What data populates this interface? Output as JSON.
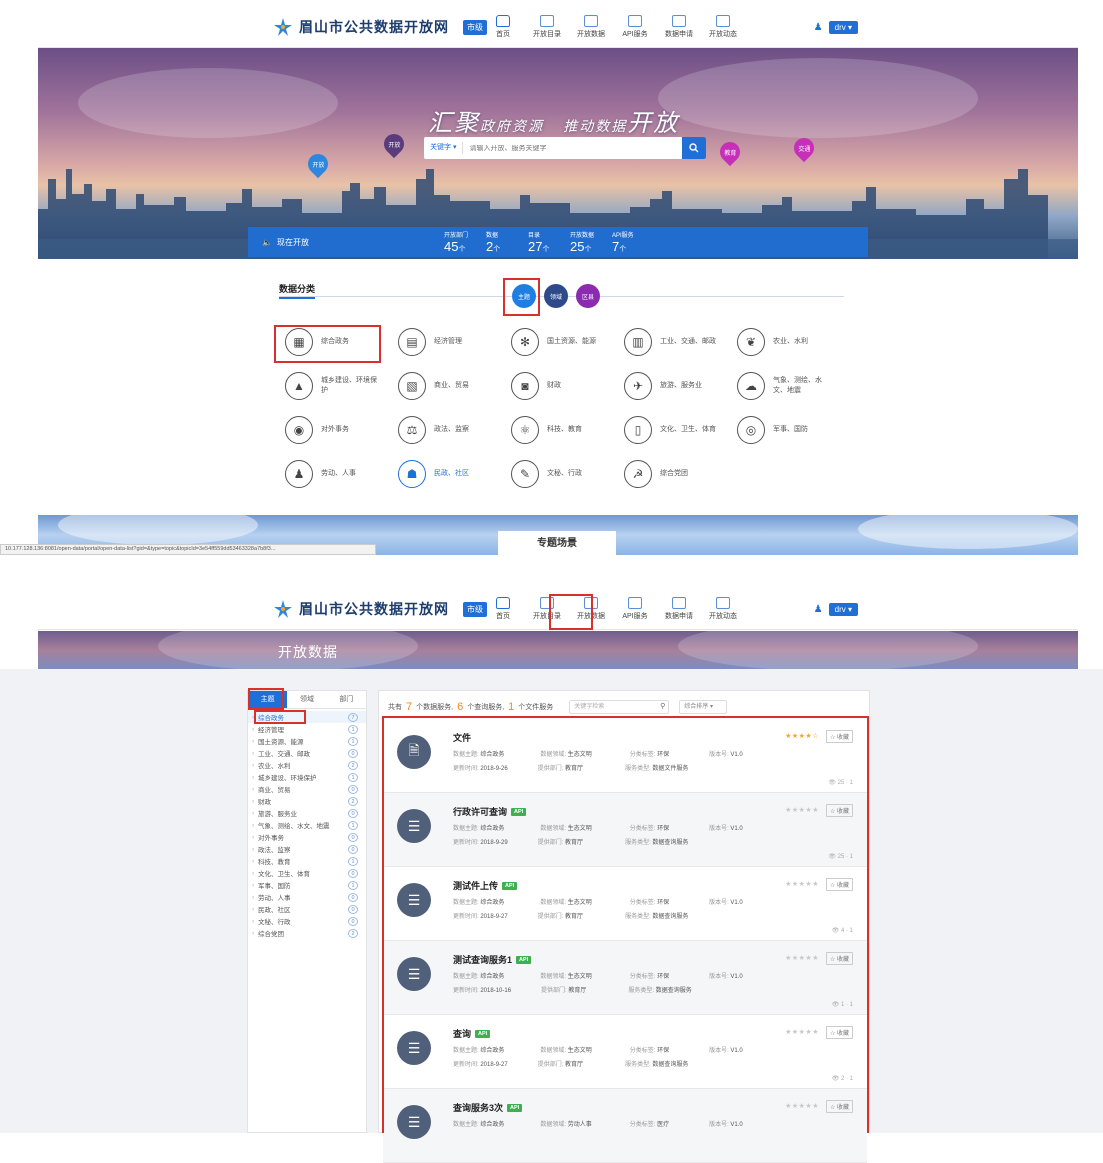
{
  "header": {
    "site_title": "眉山市公共数据开放网",
    "city_button": "市级",
    "nav": [
      "首页",
      "开放目录",
      "开放数据",
      "API服务",
      "数据申请",
      "开放动态"
    ],
    "user_button": "drv"
  },
  "hero": {
    "slogan_big1": "汇聚",
    "slogan_small1": "政府资源",
    "slogan_small2": "推动数据",
    "slogan_big2": "开放",
    "search_type": "关键字",
    "search_placeholder": "请输入开放、服务关键字",
    "pins": [
      "开放",
      "开放",
      "教育",
      "交通"
    ],
    "stats_label": "现在开放",
    "stats": [
      {
        "label": "开放部门",
        "value": "45",
        "unit": "个"
      },
      {
        "label": "数据",
        "value": "2",
        "unit": "个"
      },
      {
        "label": "目录",
        "value": "27",
        "unit": "个"
      },
      {
        "label": "开放数据",
        "value": "25",
        "unit": "个"
      },
      {
        "label": "API服务",
        "value": "7",
        "unit": "个"
      }
    ]
  },
  "categories": {
    "title": "数据分类",
    "tabs": [
      "主题",
      "领域",
      "区县"
    ],
    "items": [
      {
        "label": "综合政务",
        "icon": "▦"
      },
      {
        "label": "经济管理",
        "icon": "▤"
      },
      {
        "label": "国土资源、能源",
        "icon": "✻"
      },
      {
        "label": "工业、交通、邮政",
        "icon": "▥"
      },
      {
        "label": "农业、水利",
        "icon": "❦"
      },
      {
        "label": "城乡建设、环境保护",
        "icon": "▲"
      },
      {
        "label": "商业、贸易",
        "icon": "▧"
      },
      {
        "label": "财政",
        "icon": "◙"
      },
      {
        "label": "旅游、服务业",
        "icon": "✈"
      },
      {
        "label": "气象、测绘、水文、地震",
        "icon": "☁"
      },
      {
        "label": "对外事务",
        "icon": "◉"
      },
      {
        "label": "政法、监察",
        "icon": "⚖"
      },
      {
        "label": "科技、教育",
        "icon": "⚛"
      },
      {
        "label": "文化、卫生、体育",
        "icon": "▯"
      },
      {
        "label": "军事、国防",
        "icon": "◎"
      },
      {
        "label": "劳动、人事",
        "icon": "♟"
      },
      {
        "label": "民政、社区",
        "icon": "☗"
      },
      {
        "label": "文秘、行政",
        "icon": "✎"
      },
      {
        "label": "综合党团",
        "icon": "☭"
      }
    ]
  },
  "scene": {
    "title": "专题场景"
  },
  "status_url": "10.177.128.136:8081/open-data/portal/open-data-list?gid=&type=topic&topicId=3e54ff559dd53463328a7b8f3...",
  "open_data_page": {
    "banner_title": "开放数据",
    "side_tabs": [
      "主题",
      "领域",
      "部门"
    ],
    "side_items": [
      {
        "label": "综合政务",
        "count": "7"
      },
      {
        "label": "经济管理",
        "count": "1"
      },
      {
        "label": "国土资源、能源",
        "count": "1"
      },
      {
        "label": "工业、交通、邮政",
        "count": "0"
      },
      {
        "label": "农业、水利",
        "count": "2"
      },
      {
        "label": "城乡建设、环境保护",
        "count": "1"
      },
      {
        "label": "商业、贸易",
        "count": "0"
      },
      {
        "label": "财政",
        "count": "2"
      },
      {
        "label": "旅游、服务业",
        "count": "0"
      },
      {
        "label": "气象、测绘、水文、地震",
        "count": "1"
      },
      {
        "label": "对外事务",
        "count": "0"
      },
      {
        "label": "政法、监察",
        "count": "0"
      },
      {
        "label": "科技、教育",
        "count": "1"
      },
      {
        "label": "文化、卫生、体育",
        "count": "0"
      },
      {
        "label": "军事、国防",
        "count": "1"
      },
      {
        "label": "劳动、人事",
        "count": "0"
      },
      {
        "label": "民政、社区",
        "count": "0"
      },
      {
        "label": "文秘、行政",
        "count": "0"
      },
      {
        "label": "综合党团",
        "count": "2"
      }
    ],
    "filter_prefix": "共有",
    "count_data": "7",
    "filter_mid1": "个数据服务,",
    "count_query": "6",
    "filter_mid2": "个查询服务,",
    "count_file": "1",
    "filter_mid3": "个文件服务",
    "filter_placeholder": "关键字检索",
    "sort_label": "综合排序",
    "cards": [
      {
        "title": "文件",
        "badge": "",
        "stars": "★★★★☆",
        "fav": "收藏",
        "topic": "综合政务",
        "domain": "生态文明",
        "type": "环保",
        "version": "V1.0",
        "date": "2018-9-26",
        "dept": "教育厅",
        "kind": "数据文件服务",
        "foot": "25 · 1"
      },
      {
        "title": "行政许可查询",
        "badge": "API",
        "stars": "★★★★★",
        "fav": "收藏",
        "topic": "综合政务",
        "domain": "生态文明",
        "type": "环保",
        "version": "V1.0",
        "date": "2018-9-29",
        "dept": "教育厅",
        "kind": "数据查询服务",
        "foot": "25 · 1"
      },
      {
        "title": "测试件上传",
        "badge": "API",
        "stars": "★★★★★",
        "fav": "收藏",
        "topic": "综合政务",
        "domain": "生态文明",
        "type": "环保",
        "version": "V1.0",
        "date": "2018-9-27",
        "dept": "教育厅",
        "kind": "数据查询服务",
        "foot": "4 · 1"
      },
      {
        "title": "测试查询服务1",
        "badge": "API",
        "stars": "★★★★★",
        "fav": "收藏",
        "topic": "综合政务",
        "domain": "生态文明",
        "type": "环保",
        "version": "V1.0",
        "date": "2018-10-16",
        "dept": "教育厅",
        "kind": "数据查询服务",
        "foot": "1 · 1"
      },
      {
        "title": "查询",
        "badge": "API",
        "stars": "★★★★★",
        "fav": "收藏",
        "topic": "综合政务",
        "domain": "生态文明",
        "type": "环保",
        "version": "V1.0",
        "date": "2018-9-27",
        "dept": "教育厅",
        "kind": "数据查询服务",
        "foot": "2 · 1"
      },
      {
        "title": "查询服务3次",
        "badge": "API",
        "stars": "★★★★★",
        "fav": "收藏",
        "topic": "综合政务",
        "domain": "劳动人事",
        "type": "医疗",
        "version": "V1.0",
        "date": "",
        "dept": "",
        "kind": "",
        "foot": ""
      }
    ],
    "meta_labels": {
      "topic": "数据主题:",
      "domain": "数据领域:",
      "type": "分类标签:",
      "version": "版本号:",
      "date": "更新时间:",
      "dept": "提供部门:",
      "kind": "服务类型:"
    }
  },
  "colors": {
    "accent": "#1f6fd6",
    "highlight": "#d9302c",
    "orange": "#f08a24",
    "green": "#3db04f",
    "star": "#f5a623"
  }
}
